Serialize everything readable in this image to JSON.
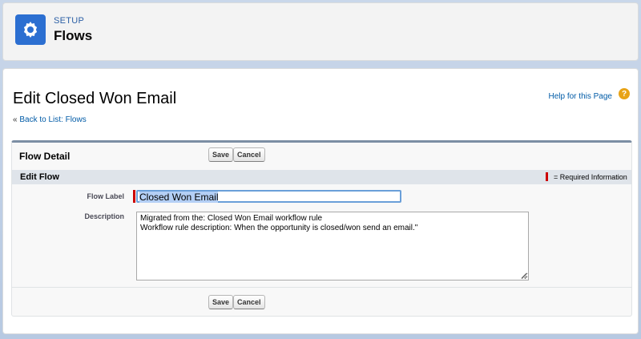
{
  "header": {
    "eyebrow": "SETUP",
    "title": "Flows",
    "icon": "gear-icon"
  },
  "main": {
    "title": "Edit Closed Won Email",
    "help_link": "Help for this Page",
    "help_icon": "question-icon",
    "back_prefix": "« ",
    "back_link": "Back to List: Flows"
  },
  "detail": {
    "title": "Flow Detail",
    "save_label": "Save",
    "cancel_label": "Cancel",
    "section_title": "Edit Flow",
    "required_text": "= Required Information"
  },
  "form": {
    "flow_label_label": "Flow Label",
    "flow_label_value": "Closed Won Email",
    "description_label": "Description",
    "description_line1": "Migrated from the: Closed Won Email workflow rule",
    "description_line2": "Workflow rule description: When the opportunity is closed/won send an email.\""
  },
  "colors": {
    "accent": "#2c6fd1",
    "link": "#015ba7",
    "required": "#cc0000",
    "help": "#e8a317"
  }
}
